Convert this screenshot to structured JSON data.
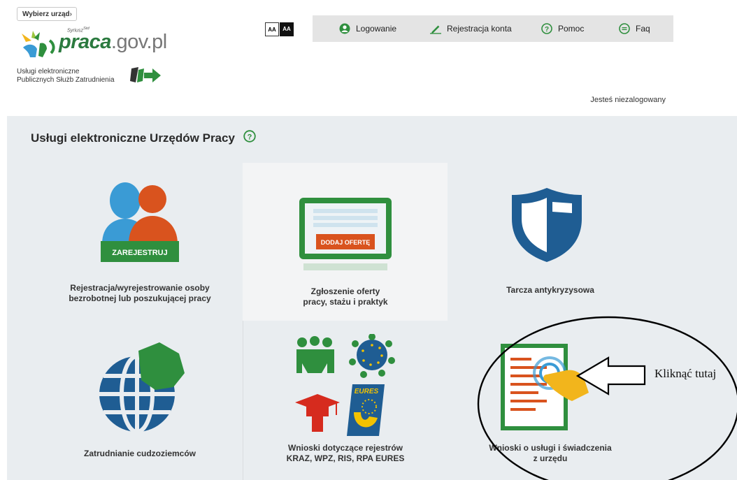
{
  "header": {
    "select_office_label": "Wybierz urząd",
    "select_office_chevron": "›",
    "logo_superscript": "Syriusz",
    "logo_superscript_std": "Std",
    "logo_main": "praca",
    "logo_domain": ".gov.pl",
    "tagline_line1": "Usługi elektroniczne",
    "tagline_line2": "Publicznych Służb Zatrudnienia",
    "font_small_label": "AA",
    "font_large_label": "AA",
    "status_text": "Jesteś niezalogowany"
  },
  "nav": {
    "items": [
      {
        "label": "Logowanie",
        "icon": "user-icon"
      },
      {
        "label": "Rejestracja konta",
        "icon": "pencil-icon"
      },
      {
        "label": "Pomoc",
        "icon": "help-icon"
      },
      {
        "label": "Faq",
        "icon": "chat-icon"
      }
    ]
  },
  "main": {
    "title": "Usługi elektroniczne Urzędów Pracy",
    "title_icon": "help-icon",
    "tiles": [
      {
        "label_line1": "Rejestracja/wyrejestrowanie osoby",
        "label_line2": "bezrobotnej lub poszukującej pracy",
        "badge": "ZAREJESTRUJ",
        "icon": "people-register-icon"
      },
      {
        "label_line1": "Zgłoszenie oferty",
        "label_line2": "pracy, stażu i praktyk",
        "badge": "DODAJ OFERTĘ",
        "icon": "job-offer-board-icon"
      },
      {
        "label_line1": "Tarcza antykryzysowa",
        "label_line2": "",
        "icon": "shield-icon"
      },
      {
        "label_line1": "Zatrudnianie cudzoziemców",
        "label_line2": "",
        "icon": "globe-icon"
      },
      {
        "label_line1": "Wnioski dotyczące rejestrów",
        "label_line2": "KRAZ, WPZ, RIS, RPA EURES",
        "eures": "EURES",
        "icon": "registers-icon"
      },
      {
        "label_line1": "Wnioski o usługi i świadczenia",
        "label_line2": "z urzędu",
        "icon": "document-touch-icon"
      }
    ]
  },
  "annotation": {
    "text": "Kliknąć tutaj"
  },
  "colors": {
    "brand_green": "#2f8f3e",
    "accent_orange": "#d9531e",
    "shield_blue": "#1f5d93",
    "panel_bg": "#e9edf0"
  }
}
